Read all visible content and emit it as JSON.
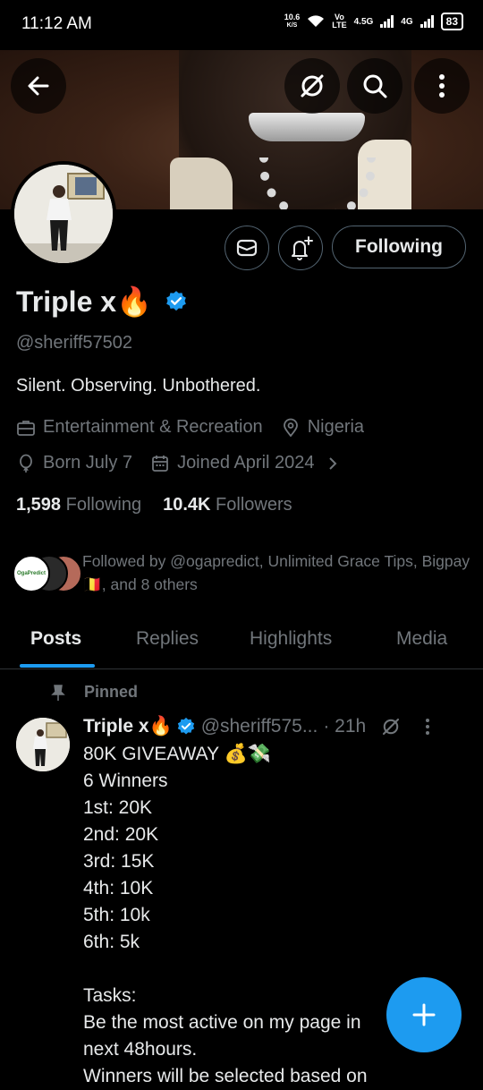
{
  "status_bar": {
    "time": "11:12 AM",
    "speed_value": "10.6",
    "speed_unit": "K/S",
    "volte_top": "Vo",
    "volte_bottom": "LTE",
    "network_1": "4.5G",
    "network_2": "4G",
    "battery": "83"
  },
  "profile": {
    "name": "Triple x🔥",
    "handle": "@sheriff57502",
    "bio": "Silent. Observing. Unbothered.",
    "category": "Entertainment & Recreation",
    "location": "Nigeria",
    "birthday": "Born July 7",
    "joined": "Joined April 2024",
    "following_count": "1,598",
    "following_label": "Following",
    "followers_count": "10.4K",
    "followers_label": "Followers",
    "follow_button": "Following",
    "followed_by": "Followed by @ogapredict, Unlimited Grace Tips, Bigpay 🇧🇪, and 8 others",
    "fav_logo_text": "OgaPredict"
  },
  "tabs": [
    "Posts",
    "Replies",
    "Highlights",
    "Media"
  ],
  "post": {
    "pinned_label": "Pinned",
    "author_name": "Triple x🔥",
    "author_handle": "@sheriff575...",
    "time": "· 21h",
    "body": "80K GIVEAWAY 💰💸\n6 Winners\n1st: 20K\n2nd: 20K\n3rd: 15K\n4th: 10K\n5th: 10k\n6th: 5k\n\nTasks:\nBe the most active on my page in\nnext 48hours.\nWinners will be selected based on"
  },
  "colors": {
    "accent": "#1d9bf0",
    "text_primary": "#e7e9ea",
    "text_secondary": "#71767b",
    "border": "#536471",
    "background": "#000000"
  },
  "icons": [
    "back-arrow-icon",
    "grok-icon",
    "search-icon",
    "more-vertical-icon",
    "mail-icon",
    "notification-bell-plus-icon",
    "verified-badge-icon",
    "briefcase-icon",
    "location-pin-icon",
    "balloon-icon",
    "calendar-icon",
    "chevron-right-icon",
    "pin-icon",
    "plus-icon"
  ]
}
